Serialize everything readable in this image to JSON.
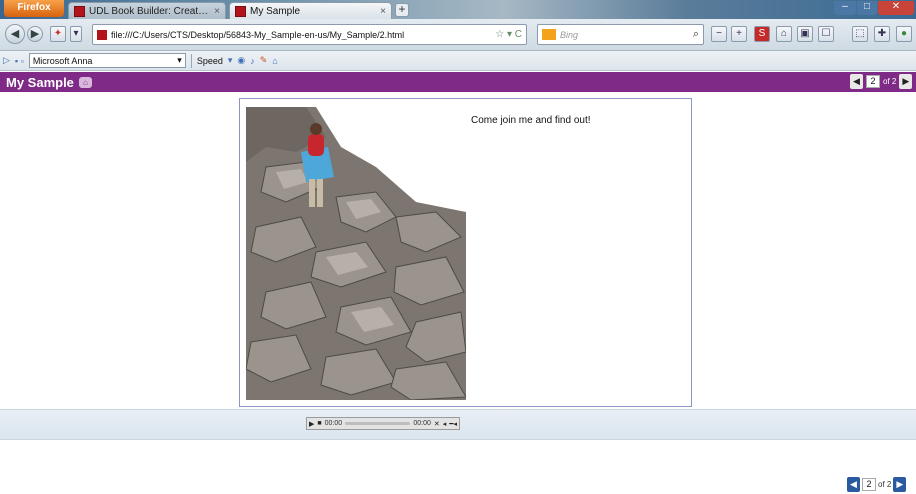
{
  "browser": {
    "menu_button": "Firefox",
    "tabs": [
      {
        "title": "UDL Book Builder: Create, Save, Edit ...",
        "close": "×"
      },
      {
        "title": "My Sample",
        "close": "×"
      }
    ],
    "new_tab": "+",
    "url": "file:///C:/Users/CTS/Desktop/56843-My_Sample-en-us/My_Sample/2.html",
    "search_placeholder": "Bing"
  },
  "speech_toolbar": {
    "voice": "Microsoft Anna",
    "speed_label": "Speed"
  },
  "book": {
    "title": "My Sample",
    "current_page": "2",
    "of_label": "of 2"
  },
  "page": {
    "caption": "Come join me and find out!",
    "photo_icon": "hiker-photo"
  },
  "player": {
    "elapsed": "00:00",
    "duration": "00:00"
  },
  "colors": {
    "book_header": "#7e2a86",
    "frame_border": "#8d95c4",
    "pager_blue": "#2a5aa0"
  }
}
